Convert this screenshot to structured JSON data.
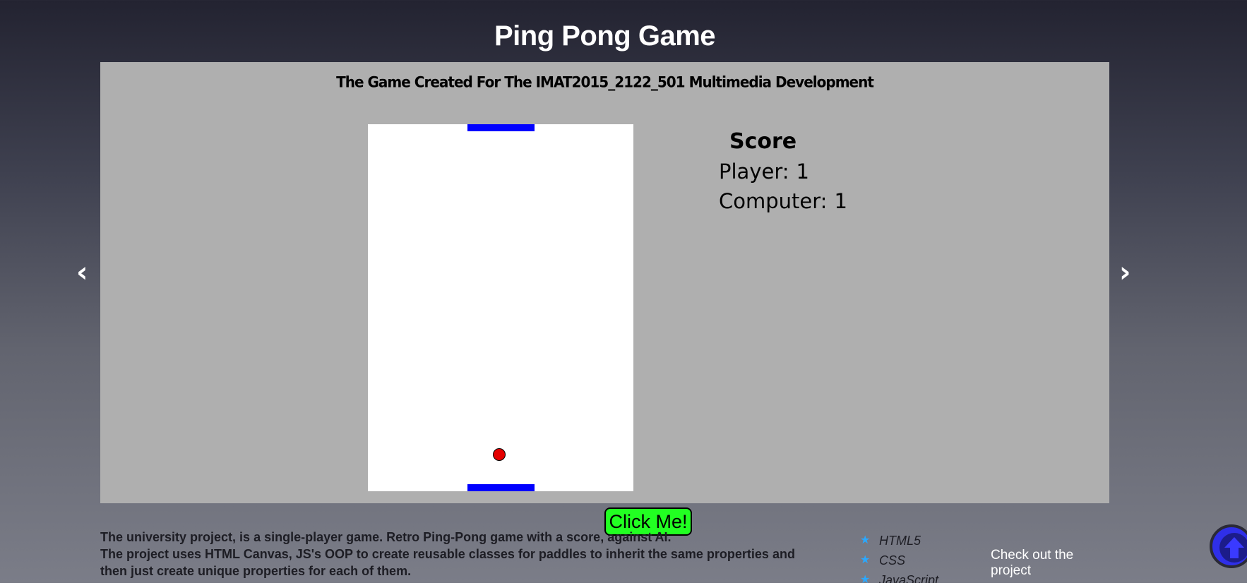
{
  "page": {
    "title": "Ping Pong Game"
  },
  "slide": {
    "heading": "The Game Created For The IMAT2015_2122_501 Multimedia Development",
    "prev_arrow": "‹",
    "next_arrow": "›"
  },
  "game": {
    "paddle_color": "#0000ff",
    "ball_color": "#e40000",
    "canvas_color": "#ffffff"
  },
  "score": {
    "title": "Score",
    "player_label": "Player:",
    "player_value": "1",
    "computer_label": "Computer:",
    "computer_value": "1"
  },
  "button": {
    "label": "Click Me!",
    "color": "#22ff22"
  },
  "description": {
    "line1": "The university project, is a single-player game. Retro Ping-Pong game with a score, against AI.",
    "line2": "The project uses HTML Canvas, JS's OOP to create reusable classes for paddles to inherit the same properties and then just create unique properties for each of them."
  },
  "tech": {
    "items": [
      "HTML5",
      "CSS",
      "JavaScript"
    ],
    "bullet_icon": "star-icon",
    "bullet_color": "#2aa8ff"
  },
  "link": {
    "label": "Check out the project"
  },
  "scroll_top": {
    "icon": "arrow-up-icon",
    "color": "#2f2fe8"
  }
}
